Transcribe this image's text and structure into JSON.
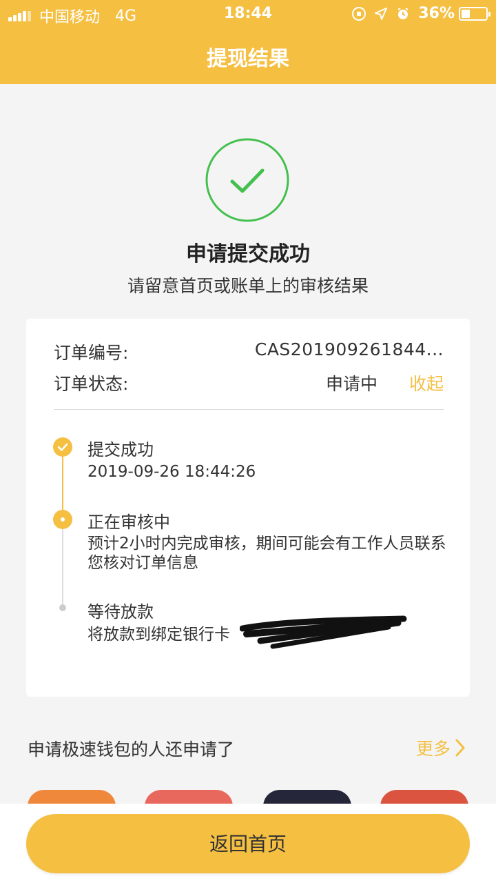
{
  "status_bar": {
    "carrier": "中国移动",
    "network": "4G",
    "time": "18:44",
    "battery_percent": "36%",
    "battery_level": 0.36,
    "icons": [
      "signal-icon",
      "rotation-lock-icon",
      "location-arrow-icon",
      "alarm-icon",
      "battery-icon"
    ]
  },
  "nav": {
    "title": "提现结果"
  },
  "result": {
    "icon": "check-circle-icon",
    "title": "申请提交成功",
    "subtitle": "请留意首页或账单上的审核结果"
  },
  "order": {
    "number_label": "订单编号:",
    "number_value": "CAS201909261844...",
    "status_label": "订单状态:",
    "status_value": "申请中",
    "collapse_label": "收起"
  },
  "timeline": [
    {
      "state": "done",
      "title": "提交成功",
      "detail": "2019-09-26 18:44:26"
    },
    {
      "state": "active",
      "title": "正在审核中",
      "detail": "预计2小时内完成审核，期间可能会有工作人员联系您核对订单信息"
    },
    {
      "state": "pending",
      "title": "等待放款",
      "detail": "将放款到绑定银行卡"
    }
  ],
  "recommend": {
    "title": "申请极速钱包的人还申请了",
    "more_label": "更多",
    "apps": [
      {
        "color": "#f0883c"
      },
      {
        "color": "#e9685e"
      },
      {
        "color": "#26263a"
      },
      {
        "color": "#db5440"
      }
    ]
  },
  "actions": {
    "home_label": "返回首页"
  },
  "colors": {
    "accent": "#f5bf42",
    "success": "#43c04d",
    "background": "#f4f4f4"
  }
}
